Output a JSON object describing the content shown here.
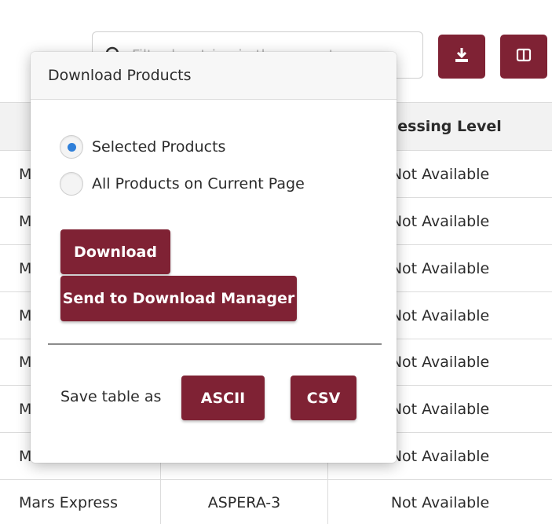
{
  "toolbar": {
    "search_placeholder": "Filter by string in the current page",
    "download_icon": "download-icon",
    "columns_icon": "columns-icon",
    "accent_color": "#7f2234"
  },
  "table": {
    "headers": [
      "",
      "",
      "Processing Level"
    ],
    "visible_header_text": "cessing Level",
    "rows": [
      {
        "mission": "M",
        "instrument": "",
        "level": "Not Available"
      },
      {
        "mission": "M",
        "instrument": "",
        "level": "Not Available"
      },
      {
        "mission": "M",
        "instrument": "",
        "level": "Not Available"
      },
      {
        "mission": "M",
        "instrument": "",
        "level": "Not Available"
      },
      {
        "mission": "M",
        "instrument": "",
        "level": "Not Available"
      },
      {
        "mission": "M",
        "instrument": "",
        "level": "Not Available"
      },
      {
        "mission": "M",
        "instrument": "",
        "level": "Not Available"
      },
      {
        "mission": "Mars Express",
        "instrument": "ASPERA-3",
        "level": "Not Available"
      }
    ]
  },
  "modal": {
    "title": "Download Products",
    "options": [
      {
        "label": "Selected Products",
        "checked": true
      },
      {
        "label": "All Products on Current Page",
        "checked": false
      }
    ],
    "download_label": "Download",
    "send_label": "Send to Download Manager",
    "save_label": "Save table as",
    "ascii_label": "ASCII",
    "csv_label": "CSV"
  }
}
